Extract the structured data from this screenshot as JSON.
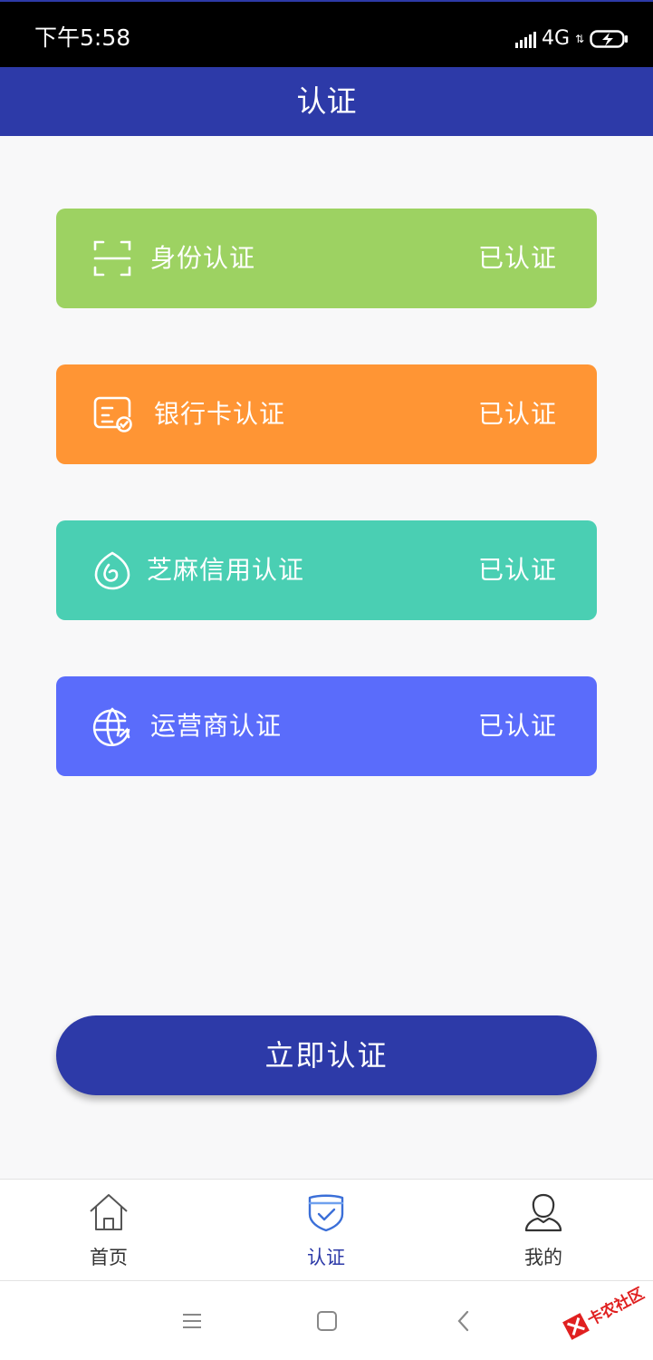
{
  "status_bar": {
    "time": "下午5:58",
    "network": "4G"
  },
  "header": {
    "title": "认证"
  },
  "cards": [
    {
      "title": "身份认证",
      "status": "已认证",
      "color": "#9dd262",
      "icon": "id-scan-icon"
    },
    {
      "title": "银行卡认证",
      "status": "已认证",
      "color": "#ff9534",
      "icon": "bank-card-icon"
    },
    {
      "title": "芝麻信用认证",
      "status": "已认证",
      "color": "#4acfb3",
      "icon": "sesame-credit-icon"
    },
    {
      "title": "运营商认证",
      "status": "已认证",
      "color": "#5a6cfb",
      "icon": "carrier-globe-icon"
    }
  ],
  "primary_button": {
    "label": "立即认证",
    "color": "#2d3aa8"
  },
  "bottom_nav": {
    "items": [
      {
        "label": "首页",
        "icon": "home-icon",
        "active": false
      },
      {
        "label": "认证",
        "icon": "shield-check-icon",
        "active": true
      },
      {
        "label": "我的",
        "icon": "user-icon",
        "active": false
      }
    ],
    "active_color": "#2d3aa8"
  },
  "system_nav": {
    "buttons": [
      "menu-icon",
      "home-square-icon",
      "back-icon"
    ]
  },
  "colors": {
    "primary": "#2d3aa8",
    "background": "#f8f8f9"
  }
}
